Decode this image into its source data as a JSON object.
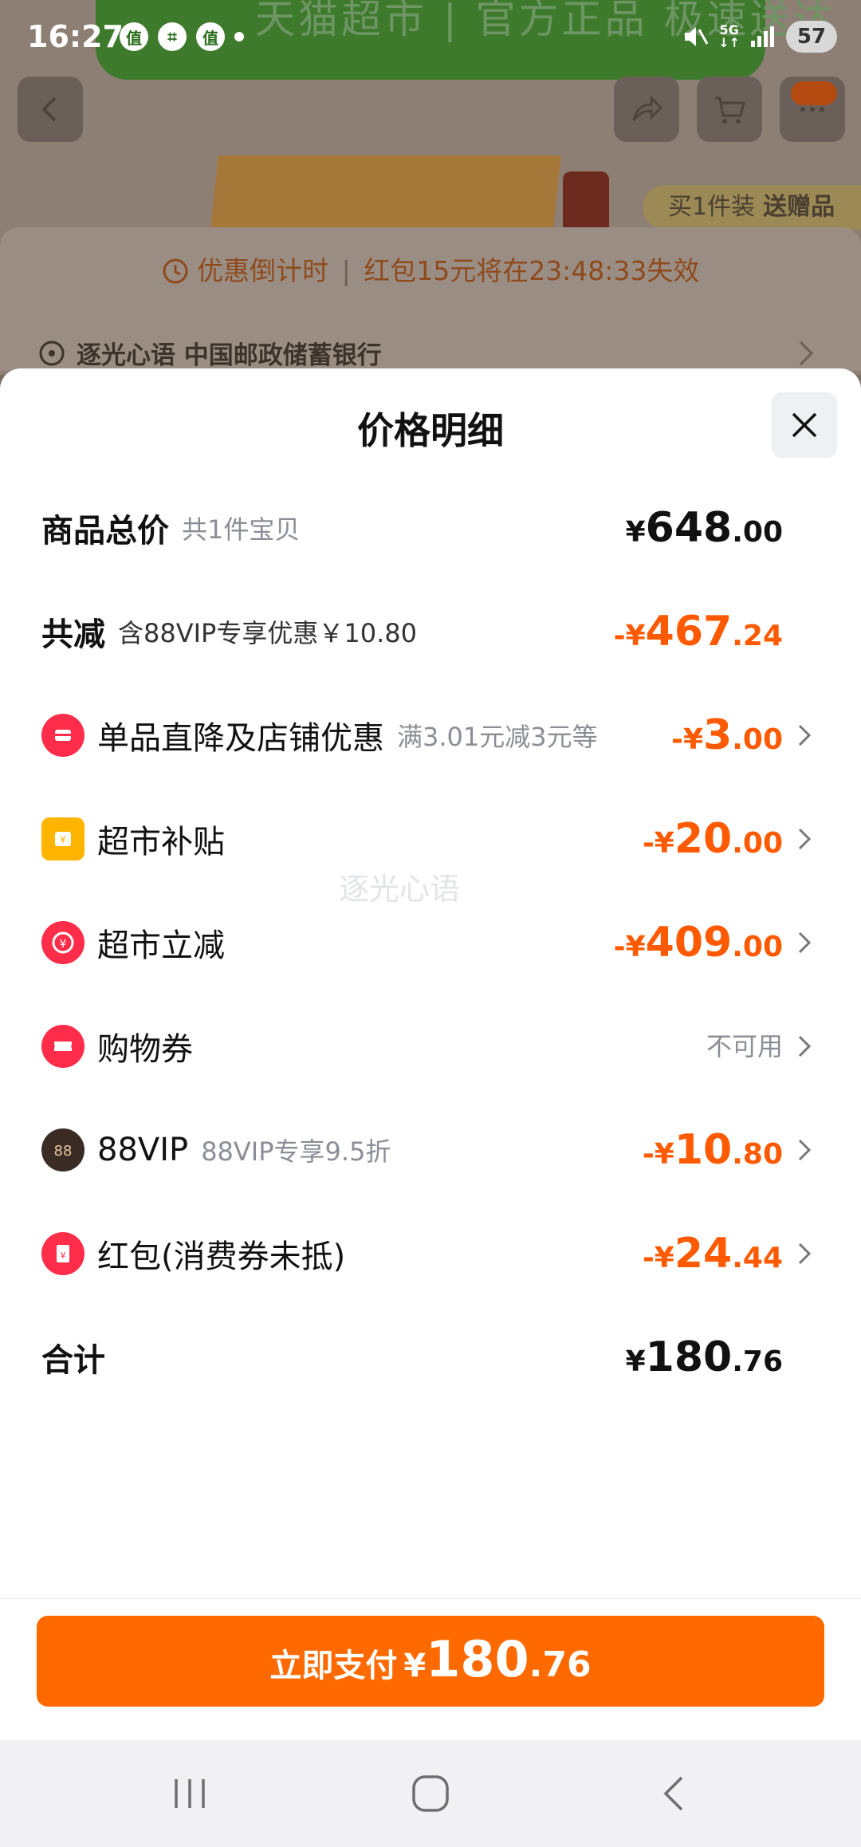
{
  "status_bar": {
    "time": "16:27",
    "network": "5G",
    "battery": "57",
    "app_badges": [
      "值",
      "值"
    ]
  },
  "background": {
    "banner_text": "天猫超市 | 官方正品 极速送达",
    "promo_tag_a": "买1件装",
    "promo_tag_b": "送赠品",
    "countdown_label": "优惠倒计时",
    "countdown_text": "红包15元将在23:48:33失效",
    "address": "逐光心语 中国邮政储蓄银行"
  },
  "sheet": {
    "title": "价格明细",
    "total": {
      "label": "商品总价",
      "sub": "共1件宝贝",
      "currency": "¥",
      "int": "648",
      "dec": ".00"
    },
    "reduce": {
      "label": "共减",
      "sub": "含88VIP专享优惠￥10.80",
      "currency": "-¥",
      "int": "467",
      "dec": ".24"
    },
    "items": [
      {
        "label": "单品直降及店铺优惠",
        "sub": "满3.01元减3元等",
        "currency": "-¥",
        "int": "3",
        "dec": ".00",
        "icon": "shop-discount-icon",
        "color": "#ff2d4a"
      },
      {
        "label": "超市补贴",
        "sub": "",
        "currency": "-¥",
        "int": "20",
        "dec": ".00",
        "icon": "subsidy-icon",
        "color": "#ffb400"
      },
      {
        "label": "超市立减",
        "sub": "",
        "currency": "-¥",
        "int": "409",
        "dec": ".00",
        "icon": "instant-discount-icon",
        "color": "#ff2d4a"
      },
      {
        "label": "购物券",
        "sub": "",
        "status": "不可用",
        "icon": "coupon-icon",
        "color": "#ff2d4a"
      },
      {
        "label": "88VIP",
        "sub": "88VIP专享9.5折",
        "currency": "-¥",
        "int": "10",
        "dec": ".80",
        "icon": "vip88-icon",
        "color": "#3a2c24"
      },
      {
        "label": "红包(消费券未抵)",
        "sub": "",
        "currency": "-¥",
        "int": "24",
        "dec": ".44",
        "icon": "red-packet-icon",
        "color": "#ff2d4a"
      }
    ],
    "grand_total": {
      "label": "合计",
      "currency": "¥",
      "int": "180",
      "dec": ".76"
    },
    "watermark": "逐光心语"
  },
  "footer": {
    "pay_label": "立即支付",
    "currency": "¥",
    "int": "180",
    "dec": ".76"
  },
  "colors": {
    "accent": "#ff6a00",
    "discount": "#ff5a00",
    "icon_red": "#ff2d4a"
  }
}
